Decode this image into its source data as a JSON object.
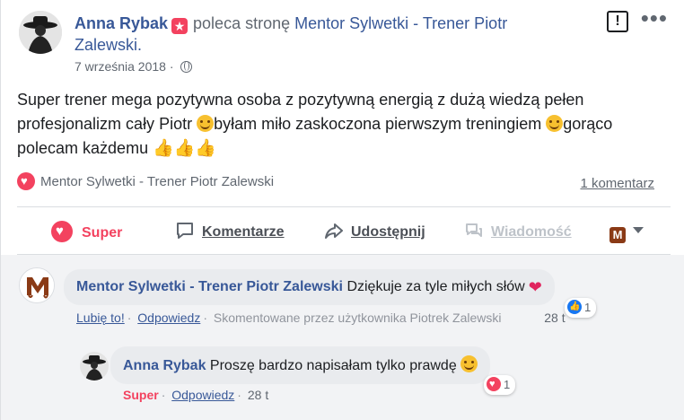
{
  "post": {
    "author": "Anna Rybak",
    "action_text": "poleca stronę",
    "page_name_line1": "Mentor Sylwetki - Trener Piotr",
    "page_name_line2": "Zalewski.",
    "date": "7 września 2018",
    "visibility_icon": "globe-icon",
    "text_part1": "Super trener mega pozytywna osoba z pozytywną energią z dużą wiedzą pełen profesjonalizm cały Piotr ",
    "text_part2": "byłam miło zaskoczona pierwszym treningiem ",
    "text_part3": "gorąco polecam każdemu ",
    "thumbs": "👍👍👍",
    "recommends_label": "Mentor Sylwetki - Trener Piotr Zalewski",
    "comments_count_label": "1 komentarz"
  },
  "actions": {
    "super": "Super",
    "comment": "Komentarze",
    "share": "Udostępnij",
    "message": "Wiadomość",
    "page_initial": "M"
  },
  "comments": [
    {
      "author": "Mentor Sylwetki - Trener Piotr Zalewski",
      "text": "Dziękuje za tyle miłych słów",
      "emoji": "❤",
      "like_label": "Lubię to!",
      "reply_label": "Odpowiedz",
      "commented_by": "Skomentowane przez użytkownika Piotrek Zalewski",
      "time": "28 t",
      "reaction_count": "1",
      "avatar_initial": "M"
    },
    {
      "author": "Anna Rybak",
      "text": "Proszę bardzo napisałam tylko prawdę",
      "like_label": "Super",
      "reply_label": "Odpowiedz",
      "time": "28 t",
      "reaction_count": "1"
    }
  ],
  "colors": {
    "link": "#385898",
    "love": "#f3425f",
    "like": "#1877f2",
    "muted": "#606770"
  }
}
